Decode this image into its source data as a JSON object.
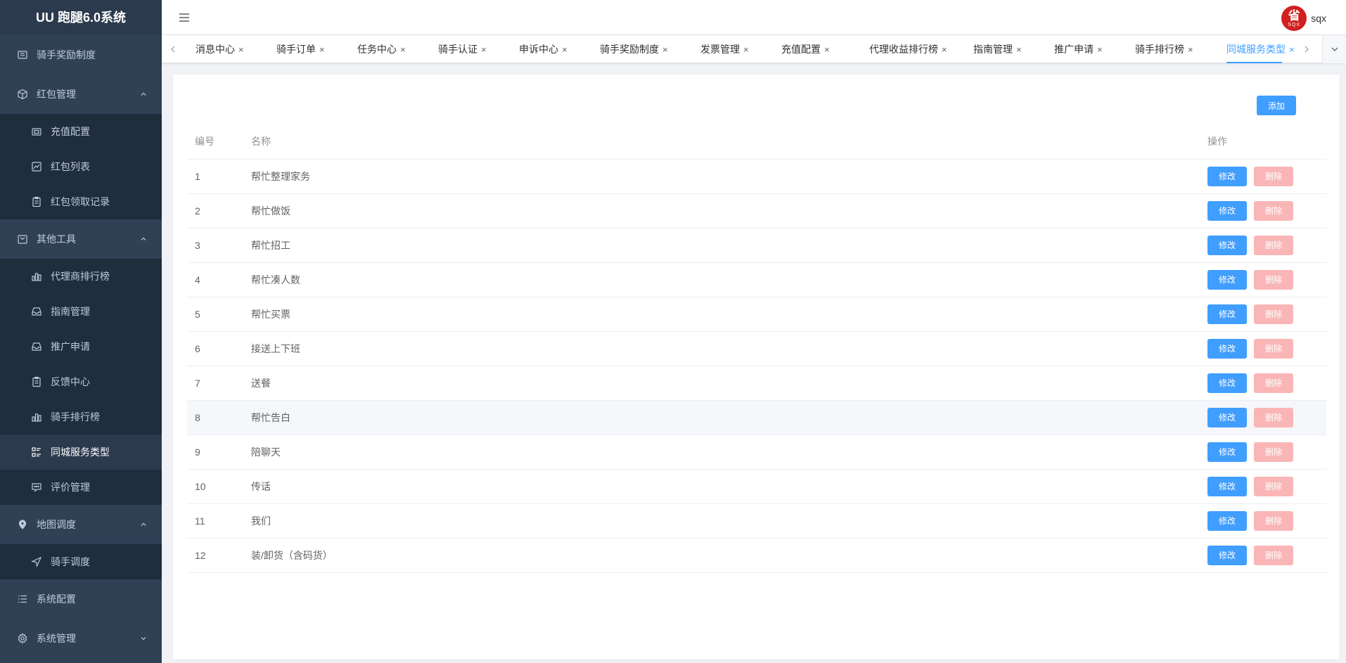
{
  "app": {
    "title": "UU 跑腿6.0系统"
  },
  "sidebar": {
    "items": [
      {
        "label": "骑手奖励制度",
        "icon": "list-icon"
      },
      {
        "label": "红包管理",
        "icon": "box-icon",
        "expanded": true,
        "children": [
          {
            "label": "充值配置",
            "icon": "wallet-icon"
          },
          {
            "label": "红包列表",
            "icon": "chart-line-icon"
          },
          {
            "label": "红包领取记录",
            "icon": "clipboard-icon"
          }
        ]
      },
      {
        "label": "其他工具",
        "icon": "toolbox-icon",
        "expanded": true,
        "children": [
          {
            "label": "代理商排行榜",
            "icon": "bar-chart-icon"
          },
          {
            "label": "指南管理",
            "icon": "inbox-icon"
          },
          {
            "label": "推广申请",
            "icon": "inbox-icon"
          },
          {
            "label": "反馈中心",
            "icon": "clipboard-icon"
          },
          {
            "label": "骑手排行榜",
            "icon": "bar-chart-icon"
          },
          {
            "label": "同城服务类型",
            "icon": "grid-list-icon",
            "active": true
          },
          {
            "label": "评价管理",
            "icon": "comment-icon"
          }
        ]
      },
      {
        "label": "地图调度",
        "icon": "location-icon",
        "expanded": true,
        "children": [
          {
            "label": "骑手调度",
            "icon": "navigation-icon"
          }
        ]
      },
      {
        "label": "系统配置",
        "icon": "list-icon"
      },
      {
        "label": "系统管理",
        "icon": "gear-icon",
        "expanded": false
      }
    ]
  },
  "header": {
    "avatar_text": "省",
    "avatar_sub": "SQX",
    "username": "sqx"
  },
  "tags": [
    {
      "label": "消息中心"
    },
    {
      "label": "骑手订单"
    },
    {
      "label": "任务中心"
    },
    {
      "label": "骑手认证"
    },
    {
      "label": "申诉中心"
    },
    {
      "label": "骑手奖励制度"
    },
    {
      "label": "发票管理"
    },
    {
      "label": "充值配置"
    },
    {
      "label": "代理收益排行榜"
    },
    {
      "label": "指南管理"
    },
    {
      "label": "推广申请"
    },
    {
      "label": "骑手排行榜"
    },
    {
      "label": "同城服务类型",
      "active": true
    }
  ],
  "main": {
    "add_label": "添加",
    "columns": {
      "id": "编号",
      "name": "名称",
      "action": "操作"
    },
    "edit_label": "修改",
    "delete_label": "删除",
    "rows": [
      {
        "id": "1",
        "name": "帮忙整理家务"
      },
      {
        "id": "2",
        "name": "帮忙做饭"
      },
      {
        "id": "3",
        "name": "帮忙招工"
      },
      {
        "id": "4",
        "name": "帮忙凑人数"
      },
      {
        "id": "5",
        "name": "帮忙买票"
      },
      {
        "id": "6",
        "name": "接送上下班"
      },
      {
        "id": "7",
        "name": "送餐"
      },
      {
        "id": "8",
        "name": "帮忙告白"
      },
      {
        "id": "9",
        "name": "陪聊天"
      },
      {
        "id": "10",
        "name": "传话"
      },
      {
        "id": "11",
        "name": "我们"
      },
      {
        "id": "12",
        "name": "装/卸货（含码货）"
      }
    ]
  },
  "colors": {
    "primary": "#409eff",
    "danger_disabled": "#fab6b6",
    "sidebar": "#304156"
  }
}
